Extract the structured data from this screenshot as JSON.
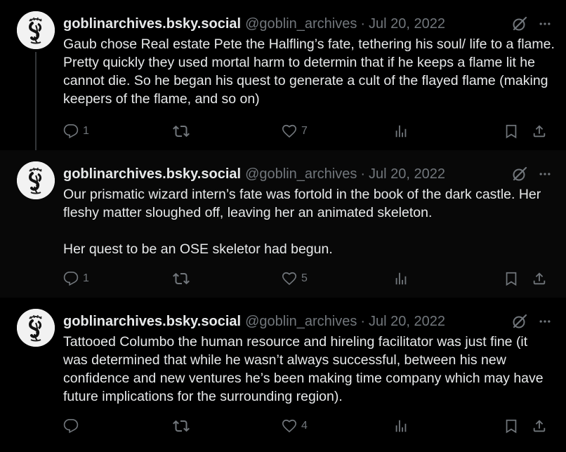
{
  "tweets": [
    {
      "display_name": "goblinarchives.bsky.social",
      "handle": "@goblin_archives",
      "separator": "·",
      "date": "Jul 20, 2022",
      "text": "Gaub chose Real estate Pete the Halfling’s fate, tethering his soul/ life to a flame. Pretty quickly they used mortal harm to determin that if he keeps a flame lit he cannot die. So he began his quest to generate a cult of the flayed flame (making keepers of the flame, and so on)",
      "replies": "1",
      "retweets": "",
      "likes": "7",
      "views": ""
    },
    {
      "display_name": "goblinarchives.bsky.social",
      "handle": "@goblin_archives",
      "separator": "·",
      "date": "Jul 20, 2022",
      "text": "Our prismatic wizard intern’s fate was fortold in the book of the dark castle. Her fleshy matter sloughed off, leaving her an animated skeleton.\n\nHer quest to be an OSE skeletor had begun.",
      "replies": "1",
      "retweets": "",
      "likes": "5",
      "views": ""
    },
    {
      "display_name": "goblinarchives.bsky.social",
      "handle": "@goblin_archives",
      "separator": "·",
      "date": "Jul 20, 2022",
      "text": "Tattooed Columbo the human resource and hireling facilitator was just fine (it was determined that while he wasn’t always successful, between his new confidence and new ventures he’s been making time company which may have future implications for the surrounding region).",
      "replies": "",
      "retweets": "",
      "likes": "4",
      "views": ""
    }
  ],
  "icons": {
    "reply": "reply-icon",
    "retweet": "retweet-icon",
    "like": "heart-icon",
    "views": "views-icon",
    "bookmark": "bookmark-icon",
    "share": "share-icon",
    "grok": "grok-icon",
    "more": "more-icon"
  },
  "colors": {
    "background": "#000000",
    "text": "#e7e9ea",
    "secondary": "#71767b"
  }
}
